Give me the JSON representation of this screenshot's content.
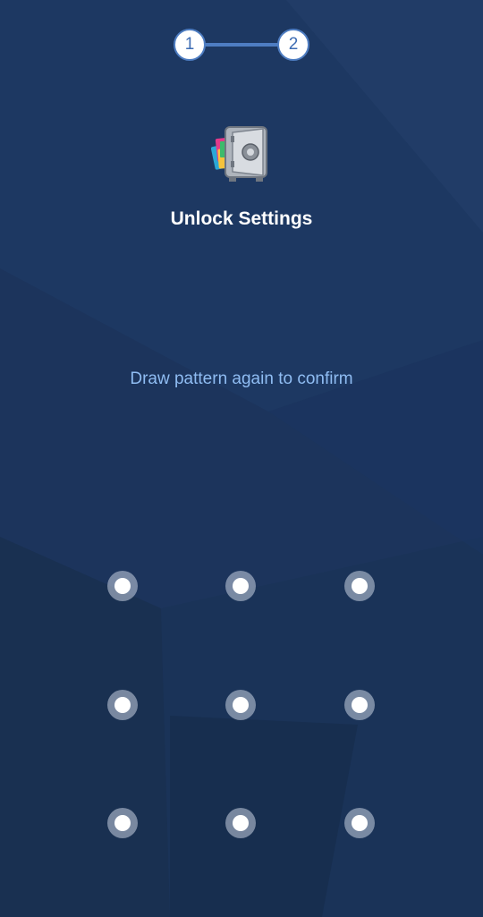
{
  "colors": {
    "background": "#1c345c",
    "accent": "#4e7dc2",
    "hint_text": "#8fbcf2",
    "title_text": "#ffffff"
  },
  "stepper": {
    "steps": [
      {
        "label": "1"
      },
      {
        "label": "2"
      }
    ]
  },
  "app": {
    "icon": "app-vault-icon",
    "title": "Unlock Settings"
  },
  "pattern": {
    "hint": "Draw pattern again to confirm",
    "rows": 3,
    "cols": 3
  }
}
